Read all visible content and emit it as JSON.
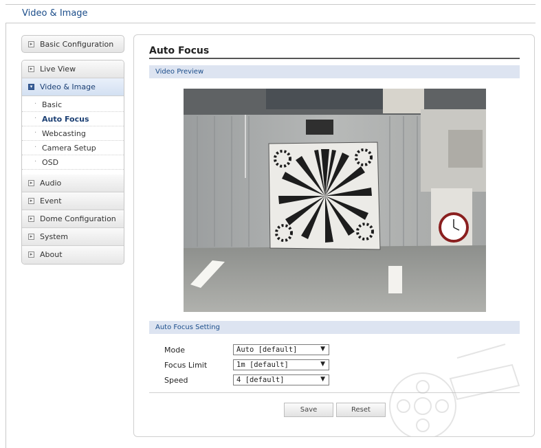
{
  "header": {
    "title": "Video & Image"
  },
  "sidebar": {
    "top_item": "Basic Configuration",
    "items": [
      {
        "label": "Live View"
      },
      {
        "label": "Video & Image",
        "active": true
      },
      {
        "label": "Audio"
      },
      {
        "label": "Event"
      },
      {
        "label": "Dome Configuration"
      },
      {
        "label": "System"
      },
      {
        "label": "About"
      }
    ],
    "sub_items": [
      {
        "label": "Basic"
      },
      {
        "label": "Auto Focus",
        "active": true
      },
      {
        "label": "Webcasting"
      },
      {
        "label": "Camera Setup"
      },
      {
        "label": "OSD"
      }
    ],
    "bullet": "·"
  },
  "main": {
    "title": "Auto Focus",
    "video_section": "Video Preview",
    "settings_section": "Auto Focus Setting",
    "fields": [
      {
        "label": "Mode",
        "value": "Auto  [default]"
      },
      {
        "label": "Focus Limit",
        "value": "1m  [default]"
      },
      {
        "label": "Speed",
        "value": "4  [default]"
      }
    ],
    "save_label": "Save",
    "reset_label": "Reset"
  },
  "icons": {
    "collapsed_box": "chevron-right-icon",
    "expanded_box": "chevron-down-icon",
    "select_arrow": "chevron-down-icon"
  },
  "colors": {
    "accent": "#1b4d8a",
    "section_bg": "#dde4f1",
    "active_nav": "#d3e0f2"
  }
}
